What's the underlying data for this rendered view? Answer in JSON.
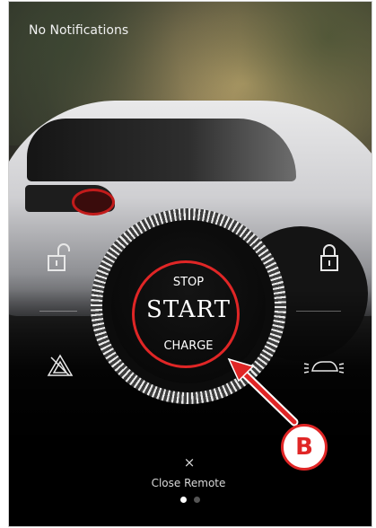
{
  "notification_text": "No Notifications",
  "remote": {
    "stop_label": "STOP",
    "start_label": "START",
    "charge_label": "CHARGE"
  },
  "callout_label": "B",
  "close_icon": "×",
  "close_label": "Close Remote",
  "pagination": {
    "current": 1,
    "total": 2
  },
  "icons": [
    "unlock-icon",
    "lock-icon",
    "hazard-icon",
    "car-lights-icon",
    "close-icon"
  ],
  "colors": {
    "accent_red": "#e02626",
    "text": "#f1f1f1",
    "dot_active": "#ffffff",
    "dot_inactive": "#555555"
  }
}
